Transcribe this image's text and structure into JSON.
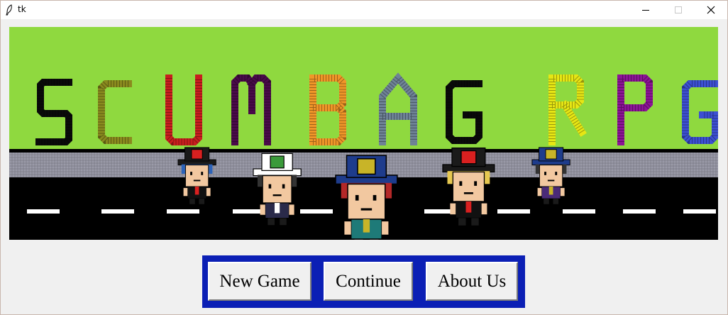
{
  "window": {
    "title": "tk",
    "controls": [
      "minimize-icon",
      "maximize-icon",
      "close-icon"
    ]
  },
  "banner": {
    "logo_letters": [
      {
        "char": "S",
        "color": "#0a0a0a"
      },
      {
        "char": "C",
        "color": "#8a8a1e"
      },
      {
        "char": "U",
        "color": "#c81e1e"
      },
      {
        "char": "M",
        "color": "#4a0a4a"
      },
      {
        "char": "B",
        "color": "#f09628"
      },
      {
        "char": "A",
        "color": "#6e8296"
      },
      {
        "char": "G",
        "color": "#0a0a0a"
      },
      {
        "char": "R",
        "color": "#e6e614"
      },
      {
        "char": "P",
        "color": "#8c1496"
      },
      {
        "char": "G",
        "color": "#3c50d2"
      }
    ],
    "sky_color": "#8fd93f",
    "sidewalk_color": "#9a9aa8",
    "road_color": "#000000",
    "characters": [
      {
        "hat": "#1a1a1a",
        "badge": "#d92020",
        "hair": "#2d63b8",
        "shirt": "#111111",
        "accent": "#d92020"
      },
      {
        "hat": "#ffffff",
        "badge": "#3a9a3a",
        "hair": "#333333",
        "shirt": "#2a2a4a",
        "accent": "#ffffff"
      },
      {
        "hat": "#1e3c8c",
        "badge": "#c8b428",
        "hair": "#b42828",
        "shirt": "#1e7a78",
        "accent": "#c8b428"
      },
      {
        "hat": "#1a1a1a",
        "badge": "#d92020",
        "hair": "#e6c850",
        "shirt": "#111111",
        "accent": "#d92020"
      },
      {
        "hat": "#1e3c8c",
        "badge": "#c8b428",
        "hair": "#333333",
        "shirt": "#4a2a78",
        "accent": "#c8b428"
      }
    ]
  },
  "menu": {
    "new_game_label": "New Game",
    "continue_label": "Continue",
    "about_label": "About Us",
    "bar_color": "#0b1fb5"
  }
}
